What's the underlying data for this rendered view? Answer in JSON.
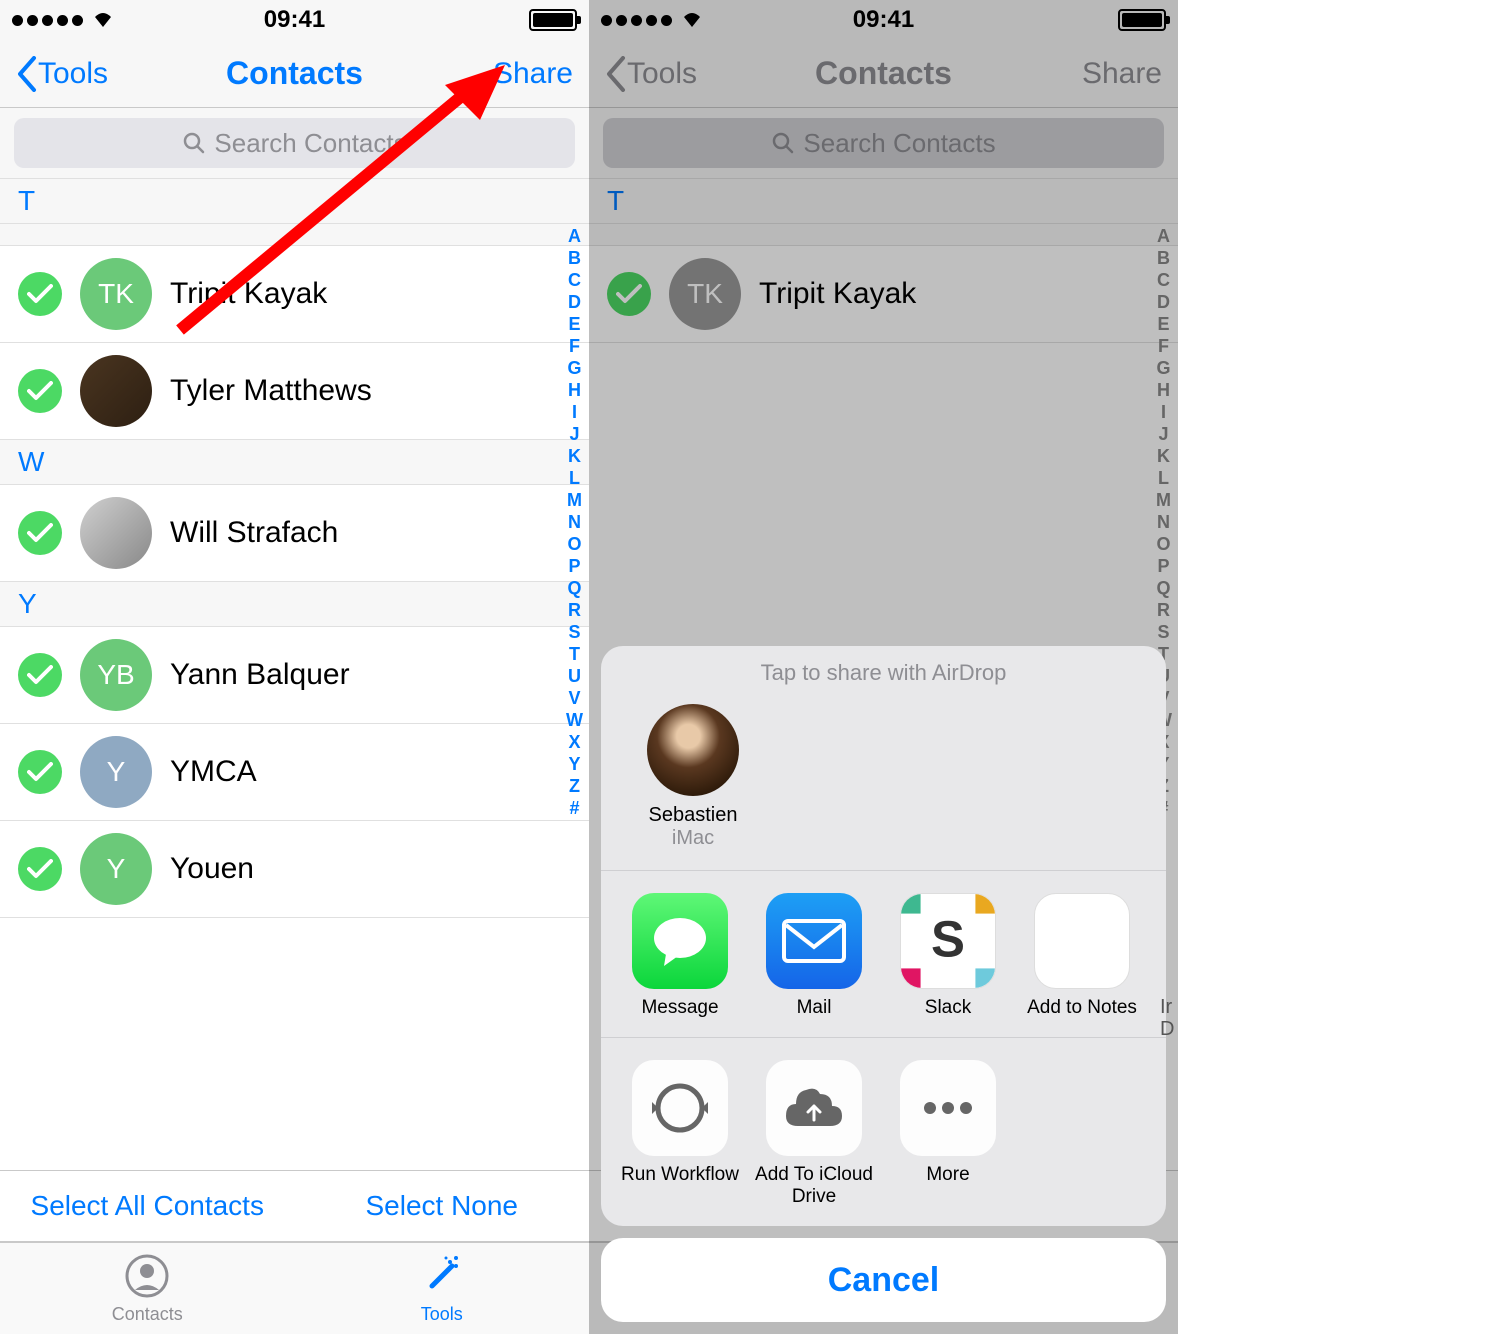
{
  "status": {
    "time": "09:41"
  },
  "nav": {
    "back": "Tools",
    "title": "Contacts",
    "share": "Share"
  },
  "search": {
    "placeholder": "Search Contacts"
  },
  "index_letters": [
    "A",
    "B",
    "C",
    "D",
    "E",
    "F",
    "G",
    "H",
    "I",
    "J",
    "K",
    "L",
    "M",
    "N",
    "O",
    "P",
    "Q",
    "R",
    "S",
    "T",
    "U",
    "V",
    "W",
    "X",
    "Y",
    "Z",
    "#"
  ],
  "sections": [
    {
      "letter": "T",
      "rows": [
        {
          "name": "Tripit Kayak",
          "initials": "TK",
          "avatar_type": "green"
        },
        {
          "name": "Tyler Matthews",
          "initials": "",
          "avatar_type": "photo1"
        }
      ]
    },
    {
      "letter": "W",
      "rows": [
        {
          "name": "Will Strafach",
          "initials": "",
          "avatar_type": "photo2"
        }
      ]
    },
    {
      "letter": "Y",
      "rows": [
        {
          "name": "Yann Balquer",
          "initials": "YB",
          "avatar_type": "green"
        },
        {
          "name": "YMCA",
          "initials": "Y",
          "avatar_type": "blue"
        },
        {
          "name": "Youen",
          "initials": "Y",
          "avatar_type": "green"
        }
      ]
    }
  ],
  "bottom": {
    "select_all": "Select All Contacts",
    "select_none": "Select None"
  },
  "tabs": {
    "contacts": "Contacts",
    "tools": "Tools"
  },
  "share_sheet": {
    "airdrop_title": "Tap to share with AirDrop",
    "airdrop_person": {
      "name": "Sebastien",
      "device": "iMac"
    },
    "apps": [
      {
        "label": "Message",
        "icon": "message"
      },
      {
        "label": "Mail",
        "icon": "mail"
      },
      {
        "label": "Slack",
        "icon": "slack"
      },
      {
        "label": "Add to Notes",
        "icon": "notes"
      }
    ],
    "actions": [
      {
        "label": "Run Workflow",
        "icon": "workflow"
      },
      {
        "label": "Add To iCloud Drive",
        "icon": "icloud"
      },
      {
        "label": "More",
        "icon": "more"
      }
    ],
    "cancel": "Cancel",
    "peek": "Ir\nD"
  }
}
